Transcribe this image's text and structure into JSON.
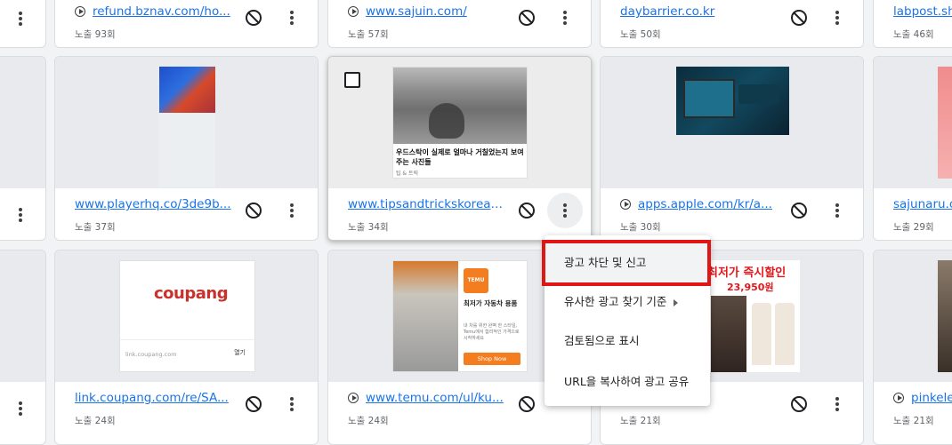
{
  "cards": {
    "r1c1": {
      "url": "refund.bznav.com/ho...",
      "count": "노출 93회"
    },
    "r1c2": {
      "url": "www.sajuin.com/",
      "count": "노출 57회"
    },
    "r1c3": {
      "url": "daybarrier.co.kr",
      "count": "노출 50회"
    },
    "r1c4": {
      "url": "labpost.sh",
      "count": "노출 46회"
    },
    "r2c1": {
      "url": "www.playerhq.co/3de9b...",
      "count": "노출 37회"
    },
    "r2c2": {
      "url": "www.tipsandtrickskorea....",
      "count": "노출 34회",
      "ad_caption": "우드스탁이 실제로 얼마나 거칠었는지 보여주는 사진들",
      "ad_source": "팁 & 트릭"
    },
    "r2c3": {
      "url": "apps.apple.com/kr/a...",
      "count": "노출 30회"
    },
    "r2c4": {
      "url": "sajunaru.c",
      "count": "노출 29회"
    },
    "r3c1": {
      "url": "link.coupang.com/re/SA...",
      "count": "노출 24회",
      "ad_logo": "coupang",
      "ad_domain": "link.coupang.com",
      "ad_open": "열기"
    },
    "r3c2": {
      "url": "www.temu.com/ul/ku...",
      "count": "노출 24회",
      "ad_brand": "TEMU",
      "ad_title": "최저가 자동차 용품",
      "ad_body": "내 차를 위한 완벽 한 스타일, Temu에서 합리적인 가격으로 시작하세요",
      "ad_cta": "Shop Now"
    },
    "r3c3": {
      "count": "노출 21회",
      "ad_headline": "최저가 즉시할인",
      "ad_price": "23,950원"
    },
    "r3c4": {
      "url": "pinkele",
      "count": "노출 21회"
    }
  },
  "menu": {
    "items": [
      "광고 차단 및 신고",
      "유사한 광고 찾기 기준",
      "검토됨으로 표시",
      "URL을 복사하여 광고 공유"
    ]
  },
  "colors": {
    "link": "#1a73e8",
    "highlight": "#e01616"
  }
}
